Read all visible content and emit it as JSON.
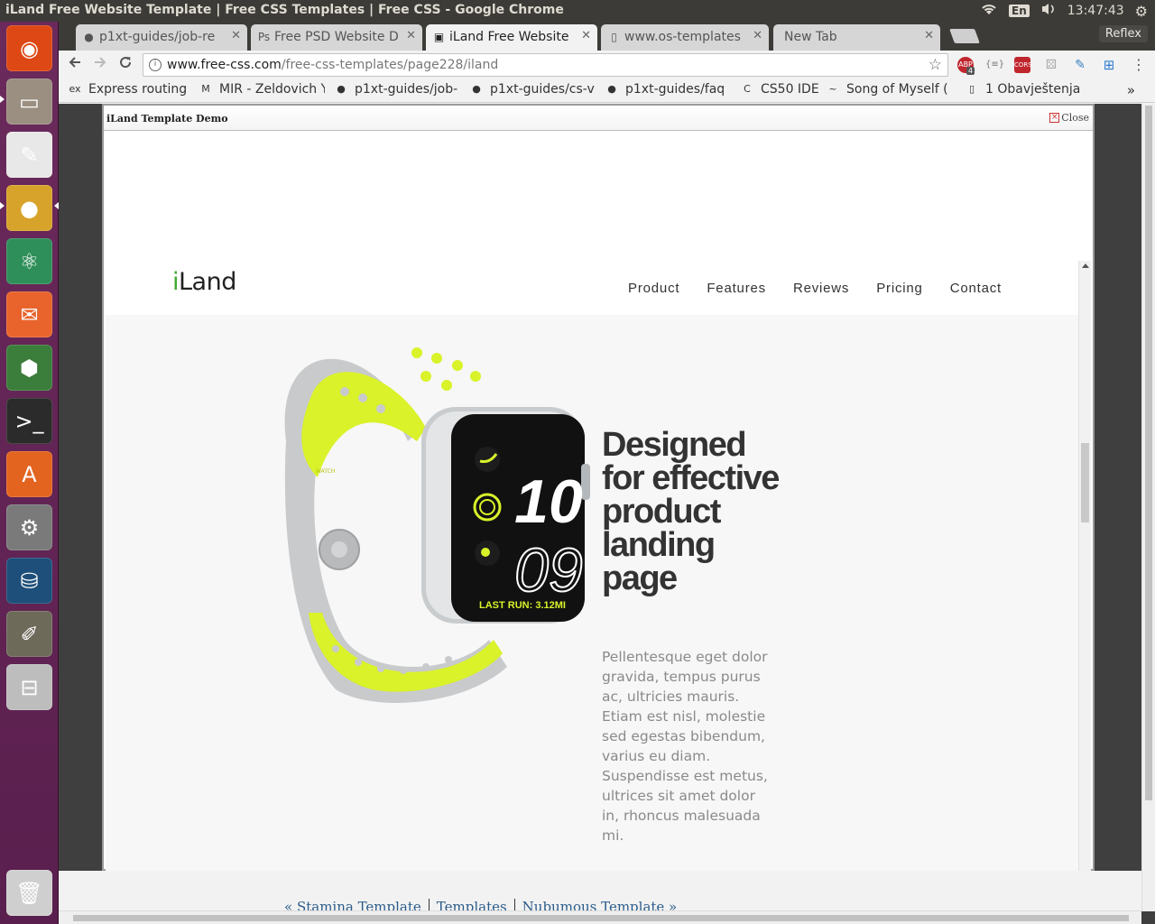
{
  "window": {
    "title": "iLand Free Website Template | Free CSS Templates | Free CSS - Google Chrome"
  },
  "tray": {
    "language": "En",
    "time": "13:47:43"
  },
  "launcher": {
    "items": [
      {
        "name": "ubuntu-dash-icon",
        "glyph": "◉",
        "color": "#dd4814"
      },
      {
        "name": "files-icon",
        "glyph": "▭",
        "color": "#9a8f80"
      },
      {
        "name": "document-viewer-icon",
        "glyph": "✎",
        "color": "#e8e8e8"
      },
      {
        "name": "chrome-icon",
        "glyph": "●",
        "color": "#d7a32a"
      },
      {
        "name": "atom-icon",
        "glyph": "⚛",
        "color": "#2f8f5a"
      },
      {
        "name": "postman-icon",
        "glyph": "✉",
        "color": "#e8642c"
      },
      {
        "name": "robomongo-icon",
        "glyph": "⬢",
        "color": "#3b7d3b"
      },
      {
        "name": "terminal-icon",
        "glyph": ">_",
        "color": "#2b2b2b"
      },
      {
        "name": "software-center-icon",
        "glyph": "A",
        "color": "#e2641f"
      },
      {
        "name": "system-settings-icon",
        "glyph": "⚙",
        "color": "#7a7a7a"
      },
      {
        "name": "mysql-workbench-icon",
        "glyph": "⛁",
        "color": "#1e4f7a"
      },
      {
        "name": "gimp-icon",
        "glyph": "✐",
        "color": "#6e6a5a"
      },
      {
        "name": "disk-icon",
        "glyph": "⊟",
        "color": "#bdbdbd"
      },
      {
        "name": "trash-icon",
        "glyph": "🗑",
        "color": "#cfcfcf"
      }
    ]
  },
  "tabs": [
    {
      "label": "p1xt-guides/job-re",
      "icon": "github-icon",
      "active": false
    },
    {
      "label": "Free PSD Website D",
      "icon": "psd-icon",
      "active": false
    },
    {
      "label": "iLand Free Website",
      "icon": "css-icon",
      "active": true
    },
    {
      "label": "www.os-templates",
      "icon": "page-icon",
      "active": false
    },
    {
      "label": "New Tab",
      "icon": "",
      "active": false
    }
  ],
  "profile": "Reflex",
  "omnibox": {
    "host": "www.free-css.com",
    "path": "/free-css-templates/page228/iland"
  },
  "extensions": [
    "ABP",
    "{≡}",
    "CORS",
    "⚄",
    "✎",
    "⊞",
    "⋮"
  ],
  "abp_count": "4",
  "bookmarks": [
    {
      "label": "Express routing",
      "icon": "ex"
    },
    {
      "label": "MIR - Zeldovich Y",
      "icon": "M"
    },
    {
      "label": "p1xt-guides/job-",
      "icon": "github-icon"
    },
    {
      "label": "p1xt-guides/cs-v",
      "icon": "github-icon"
    },
    {
      "label": "p1xt-guides/faq",
      "icon": "github-icon"
    },
    {
      "label": "CS50 IDE",
      "icon": "C"
    },
    {
      "label": "Song of Myself (",
      "icon": "~"
    },
    {
      "label": "1 Obavještenja",
      "icon": "page-icon"
    }
  ],
  "bookmarks_more": "»",
  "lightbox": {
    "title": "iLand Template Demo",
    "close_label": "Close"
  },
  "site": {
    "logo_i": "i",
    "logo_rest": "Land",
    "nav": [
      "Product",
      "Features",
      "Reviews",
      "Pricing",
      "Contact"
    ],
    "hero_title": "Designed for effective product landing page",
    "hero_body": "Pellentesque eget dolor gravida, tempus purus ac, ultricies mauris. Etiam est nisl, molestie sed egestas bibendum, varius eu diam. Suspendisse est metus, ultrices sit amet dolor in, rhoncus malesuada mi.",
    "watch": {
      "top_number": "10",
      "bottom_number": "09",
      "caption": "LAST RUN: 3.12MI",
      "band_text": "WATCH",
      "band_color": "#d9f22a",
      "case_color": "#c9ccce"
    }
  },
  "pager": {
    "prev": "« Stamina Template",
    "middle": "Templates",
    "next": "Nubumous Template »"
  }
}
